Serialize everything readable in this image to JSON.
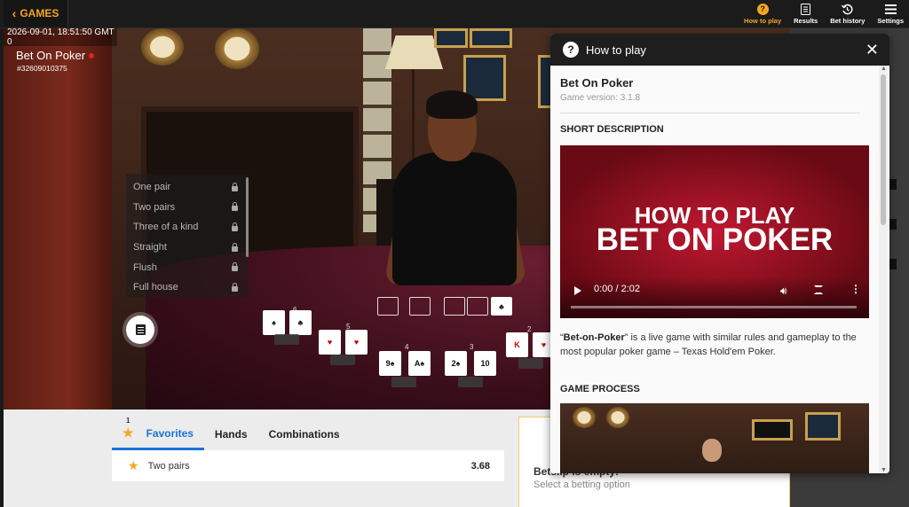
{
  "topbar": {
    "games_label": "GAMES",
    "nav": [
      {
        "label": "How to play",
        "icon": "help-icon"
      },
      {
        "label": "Results",
        "icon": "results-icon"
      },
      {
        "label": "Bet history",
        "icon": "history-icon"
      },
      {
        "label": "Settings",
        "icon": "menu-icon"
      }
    ]
  },
  "game": {
    "timestamp": "2026-09-01, 18:51:50 GMT 0",
    "title": "Bet On Poker",
    "id": "#32609010375"
  },
  "hands_list": [
    "One pair",
    "Two pairs",
    "Three of a kind",
    "Straight",
    "Flush",
    "Full house"
  ],
  "hand_labels": [
    "6",
    "5",
    "4",
    "3",
    "2"
  ],
  "bottom": {
    "fav_count": "1",
    "tabs": [
      "Favorites",
      "Hands",
      "Combinations"
    ],
    "favorites": [
      {
        "name": "Two pairs",
        "odds": "3.68"
      }
    ],
    "betslip_title": "Betslip is empty!",
    "betslip_sub": "Select a betting option"
  },
  "panel": {
    "header": "How to play",
    "game_title": "Bet On Poker",
    "version": "Game version: 3.1.8",
    "short_desc_heading": "SHORT DESCRIPTION",
    "video_line1": "HOW TO PLAY",
    "video_line2": "BET ON POKER",
    "video_time": "0:00 / 2:02",
    "desc_bold": "Bet-on-Poker",
    "desc_rest": " is a live game with similar rules and gameplay to the most popular poker game – Texas Hold'em Poker.",
    "game_process_heading": "GAME PROCESS"
  },
  "colors": {
    "accent": "#f5a623",
    "active_tab": "#1a73d9",
    "header_bg": "#1e1e1e"
  }
}
